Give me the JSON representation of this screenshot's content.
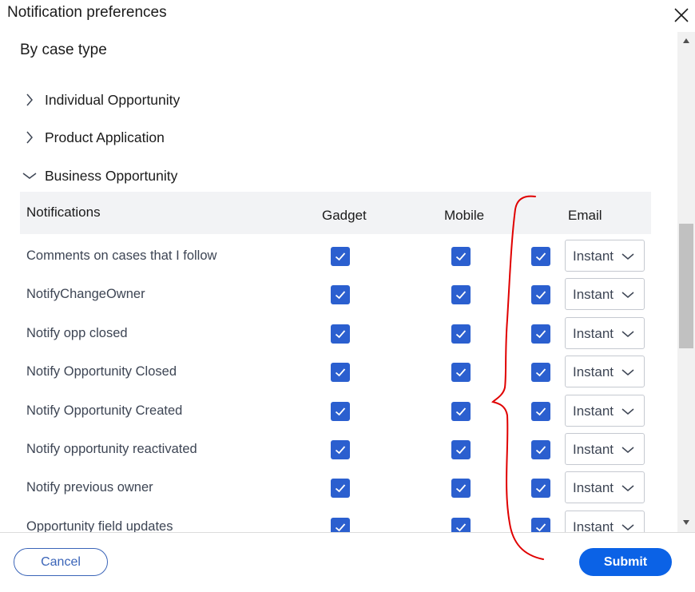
{
  "dialog": {
    "title": "Notification preferences"
  },
  "section": {
    "title": "By case type"
  },
  "case_types": [
    {
      "label": "Individual Opportunity",
      "expanded": false
    },
    {
      "label": "Product Application",
      "expanded": false
    },
    {
      "label": "Business Opportunity",
      "expanded": true
    }
  ],
  "table": {
    "headers": {
      "notifications": "Notifications",
      "gadget": "Gadget",
      "mobile": "Mobile",
      "email": "Email"
    },
    "rows": [
      {
        "label": "Comments on cases that I follow",
        "gadget": true,
        "mobile": true,
        "email": true,
        "frequency": "Instant"
      },
      {
        "label": "NotifyChangeOwner",
        "gadget": true,
        "mobile": true,
        "email": true,
        "frequency": "Instant"
      },
      {
        "label": "Notify opp closed",
        "gadget": true,
        "mobile": true,
        "email": true,
        "frequency": "Instant"
      },
      {
        "label": "Notify Opportunity Closed",
        "gadget": true,
        "mobile": true,
        "email": true,
        "frequency": "Instant"
      },
      {
        "label": "Notify Opportunity Created",
        "gadget": true,
        "mobile": true,
        "email": true,
        "frequency": "Instant"
      },
      {
        "label": "Notify opportunity reactivated",
        "gadget": true,
        "mobile": true,
        "email": true,
        "frequency": "Instant"
      },
      {
        "label": "Notify previous owner",
        "gadget": true,
        "mobile": true,
        "email": true,
        "frequency": "Instant"
      },
      {
        "label": "Opportunity field updates",
        "gadget": true,
        "mobile": true,
        "email": true,
        "frequency": "Instant"
      }
    ]
  },
  "footer": {
    "cancel_label": "Cancel",
    "submit_label": "Submit"
  },
  "colors": {
    "checkbox": "#2b5fcf",
    "submit": "#0b62e6",
    "cancel_border": "#3a64b8",
    "annotation": "#e00000",
    "header_bg": "#f2f3f5"
  },
  "icons": {
    "close": "close-icon",
    "collapsed": "chevron-right-icon",
    "expanded": "chevron-down-icon",
    "select": "chevron-down-icon"
  }
}
